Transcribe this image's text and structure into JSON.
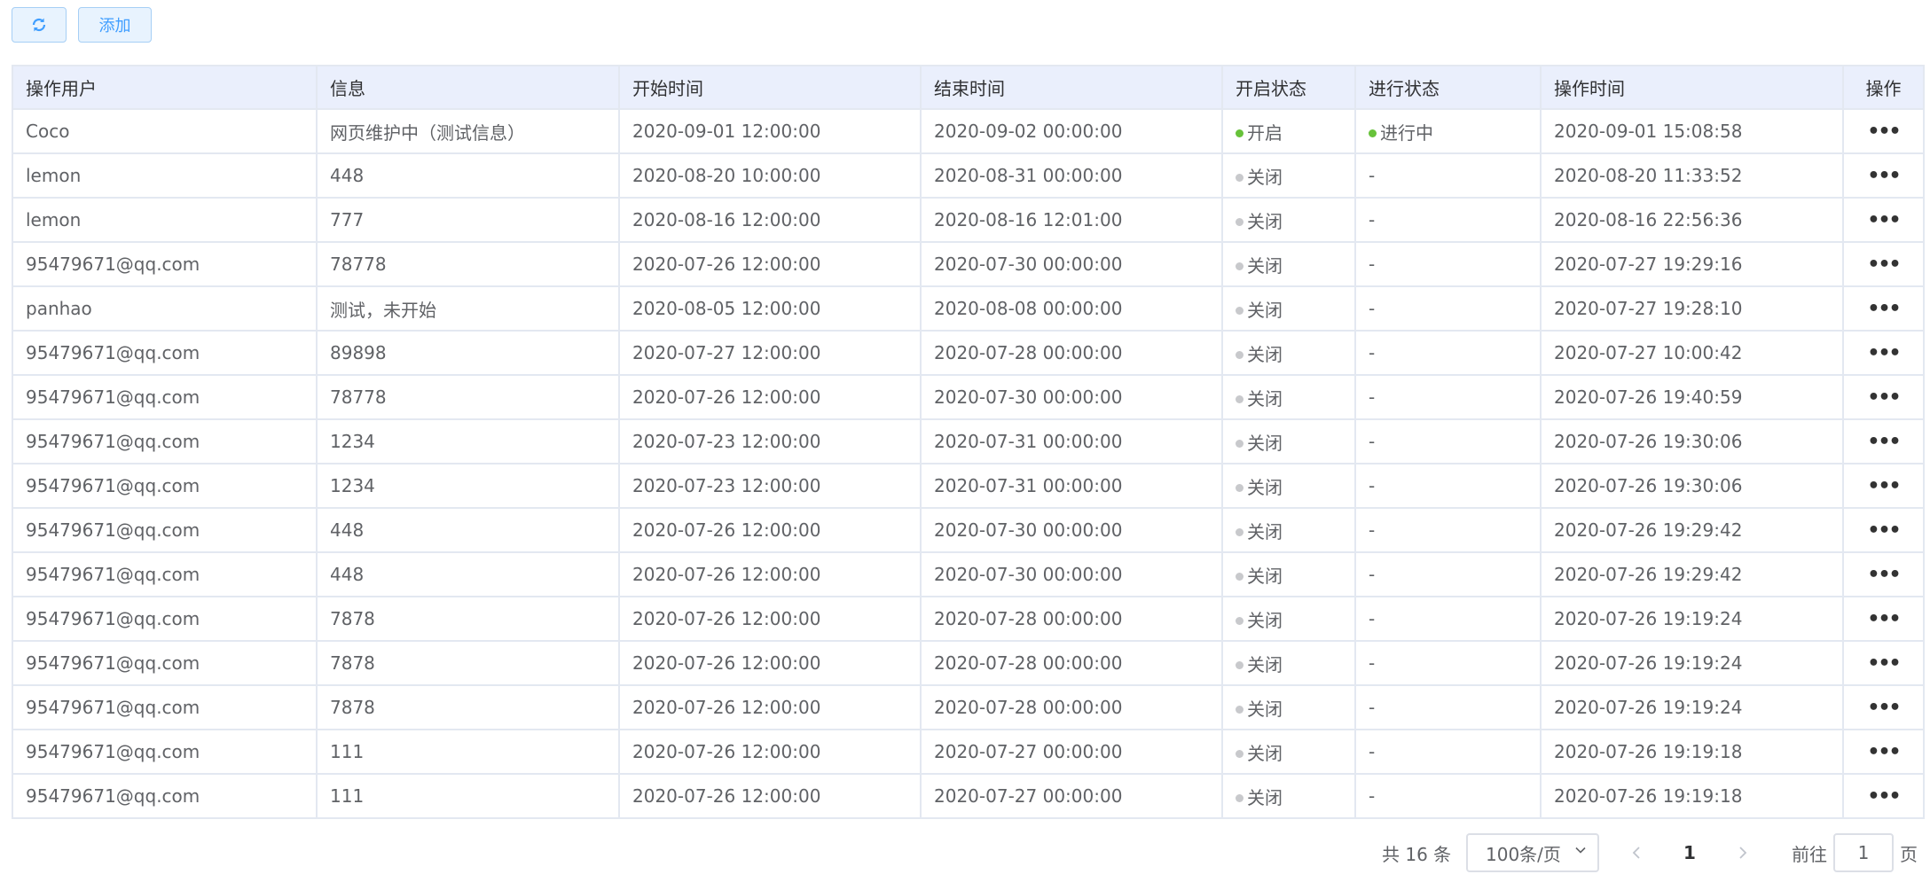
{
  "toolbar": {
    "add_label": "添加",
    "refresh_icon": "refresh-icon"
  },
  "table": {
    "headers": [
      "操作用户",
      "信息",
      "开始时间",
      "结束时间",
      "开启状态",
      "进行状态",
      "操作时间",
      "操作"
    ],
    "rows": [
      {
        "user": "Coco",
        "info": "网页维护中（测试信息）",
        "start": "2020-09-01 12:00:00",
        "end": "2020-09-02 00:00:00",
        "open": "开启",
        "open_on": true,
        "progress": "进行中",
        "progress_on": true,
        "op_time": "2020-09-01 15:08:58"
      },
      {
        "user": "lemon",
        "info": "448",
        "start": "2020-08-20 10:00:00",
        "end": "2020-08-31 00:00:00",
        "open": "关闭",
        "open_on": false,
        "progress": "-",
        "progress_on": false,
        "op_time": "2020-08-20 11:33:52"
      },
      {
        "user": "lemon",
        "info": "777",
        "start": "2020-08-16 12:00:00",
        "end": "2020-08-16 12:01:00",
        "open": "关闭",
        "open_on": false,
        "progress": "-",
        "progress_on": false,
        "op_time": "2020-08-16 22:56:36"
      },
      {
        "user": "95479671@qq.com",
        "info": "78778",
        "start": "2020-07-26 12:00:00",
        "end": "2020-07-30 00:00:00",
        "open": "关闭",
        "open_on": false,
        "progress": "-",
        "progress_on": false,
        "op_time": "2020-07-27 19:29:16"
      },
      {
        "user": "panhao",
        "info": "测试，未开始",
        "start": "2020-08-05 12:00:00",
        "end": "2020-08-08 00:00:00",
        "open": "关闭",
        "open_on": false,
        "progress": "-",
        "progress_on": false,
        "op_time": "2020-07-27 19:28:10"
      },
      {
        "user": "95479671@qq.com",
        "info": "89898",
        "start": "2020-07-27 12:00:00",
        "end": "2020-07-28 00:00:00",
        "open": "关闭",
        "open_on": false,
        "progress": "-",
        "progress_on": false,
        "op_time": "2020-07-27 10:00:42"
      },
      {
        "user": "95479671@qq.com",
        "info": "78778",
        "start": "2020-07-26 12:00:00",
        "end": "2020-07-30 00:00:00",
        "open": "关闭",
        "open_on": false,
        "progress": "-",
        "progress_on": false,
        "op_time": "2020-07-26 19:40:59"
      },
      {
        "user": "95479671@qq.com",
        "info": "1234",
        "start": "2020-07-23 12:00:00",
        "end": "2020-07-31 00:00:00",
        "open": "关闭",
        "open_on": false,
        "progress": "-",
        "progress_on": false,
        "op_time": "2020-07-26 19:30:06"
      },
      {
        "user": "95479671@qq.com",
        "info": "1234",
        "start": "2020-07-23 12:00:00",
        "end": "2020-07-31 00:00:00",
        "open": "关闭",
        "open_on": false,
        "progress": "-",
        "progress_on": false,
        "op_time": "2020-07-26 19:30:06"
      },
      {
        "user": "95479671@qq.com",
        "info": "448",
        "start": "2020-07-26 12:00:00",
        "end": "2020-07-30 00:00:00",
        "open": "关闭",
        "open_on": false,
        "progress": "-",
        "progress_on": false,
        "op_time": "2020-07-26 19:29:42"
      },
      {
        "user": "95479671@qq.com",
        "info": "448",
        "start": "2020-07-26 12:00:00",
        "end": "2020-07-30 00:00:00",
        "open": "关闭",
        "open_on": false,
        "progress": "-",
        "progress_on": false,
        "op_time": "2020-07-26 19:29:42"
      },
      {
        "user": "95479671@qq.com",
        "info": "7878",
        "start": "2020-07-26 12:00:00",
        "end": "2020-07-28 00:00:00",
        "open": "关闭",
        "open_on": false,
        "progress": "-",
        "progress_on": false,
        "op_time": "2020-07-26 19:19:24"
      },
      {
        "user": "95479671@qq.com",
        "info": "7878",
        "start": "2020-07-26 12:00:00",
        "end": "2020-07-28 00:00:00",
        "open": "关闭",
        "open_on": false,
        "progress": "-",
        "progress_on": false,
        "op_time": "2020-07-26 19:19:24"
      },
      {
        "user": "95479671@qq.com",
        "info": "7878",
        "start": "2020-07-26 12:00:00",
        "end": "2020-07-28 00:00:00",
        "open": "关闭",
        "open_on": false,
        "progress": "-",
        "progress_on": false,
        "op_time": "2020-07-26 19:19:24"
      },
      {
        "user": "95479671@qq.com",
        "info": "111",
        "start": "2020-07-26 12:00:00",
        "end": "2020-07-27 00:00:00",
        "open": "关闭",
        "open_on": false,
        "progress": "-",
        "progress_on": false,
        "op_time": "2020-07-26 19:19:18"
      },
      {
        "user": "95479671@qq.com",
        "info": "111",
        "start": "2020-07-26 12:00:00",
        "end": "2020-07-27 00:00:00",
        "open": "关闭",
        "open_on": false,
        "progress": "-",
        "progress_on": false,
        "op_time": "2020-07-26 19:19:18"
      }
    ],
    "more_label": "•••",
    "more_icon": "more-icon"
  },
  "pagination": {
    "total_label": "共 16 条",
    "page_size": "100条/页",
    "current_page": "1",
    "goto_prefix": "前往",
    "goto_value": "1",
    "goto_suffix": "页"
  },
  "colors": {
    "accent": "#409eff",
    "on_dot": "#67c23a",
    "off_dot": "#c8c9cc",
    "header_bg": "#eaeffc"
  }
}
